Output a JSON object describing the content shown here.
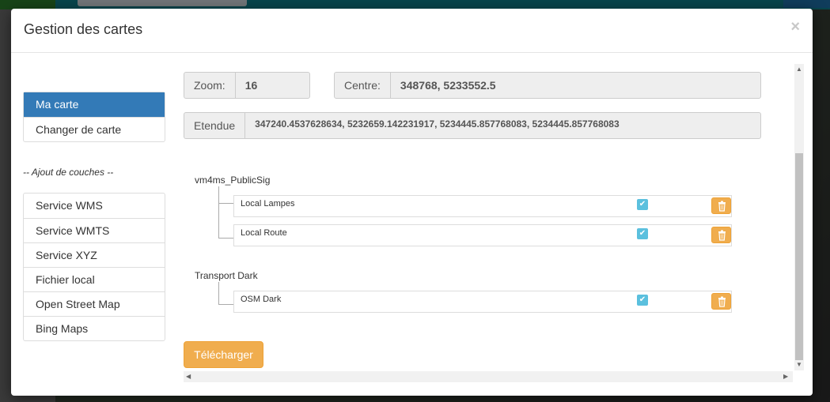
{
  "modal": {
    "title": "Gestion des cartes",
    "close": "×"
  },
  "sidebar": {
    "top_items": [
      {
        "label": "Ma carte",
        "active": true
      },
      {
        "label": "Changer de carte",
        "active": false
      }
    ],
    "separator": "-- Ajout de couches --",
    "services": [
      {
        "label": "Service WMS"
      },
      {
        "label": "Service WMTS"
      },
      {
        "label": "Service XYZ"
      },
      {
        "label": "Fichier local"
      },
      {
        "label": "Open Street Map"
      },
      {
        "label": "Bing Maps"
      }
    ]
  },
  "map_info": {
    "zoom_label": "Zoom:",
    "zoom_value": "16",
    "center_label": "Centre:",
    "center_value": "348768, 5233552.5",
    "extent_label": "Etendue",
    "extent_value": "347240.4537628634, 5232659.142231917, 5234445.857768083, 5234445.857768083"
  },
  "groups": [
    {
      "name": "vm4ms_PublicSig",
      "layers": [
        {
          "name": "Local Lampes",
          "checked": true
        },
        {
          "name": "Local Route",
          "checked": true
        }
      ]
    },
    {
      "name": "Transport Dark",
      "layers": [
        {
          "name": "OSM Dark",
          "checked": true
        }
      ]
    }
  ],
  "download_label": "Télécharger",
  "colors": {
    "active": "#337ab7",
    "warning": "#f0ad4e",
    "checkbox": "#5bc0de"
  },
  "icons": {
    "check": "✔",
    "scroll_up": "▲",
    "scroll_down": "▼",
    "scroll_left": "◀",
    "scroll_right": "▶"
  }
}
